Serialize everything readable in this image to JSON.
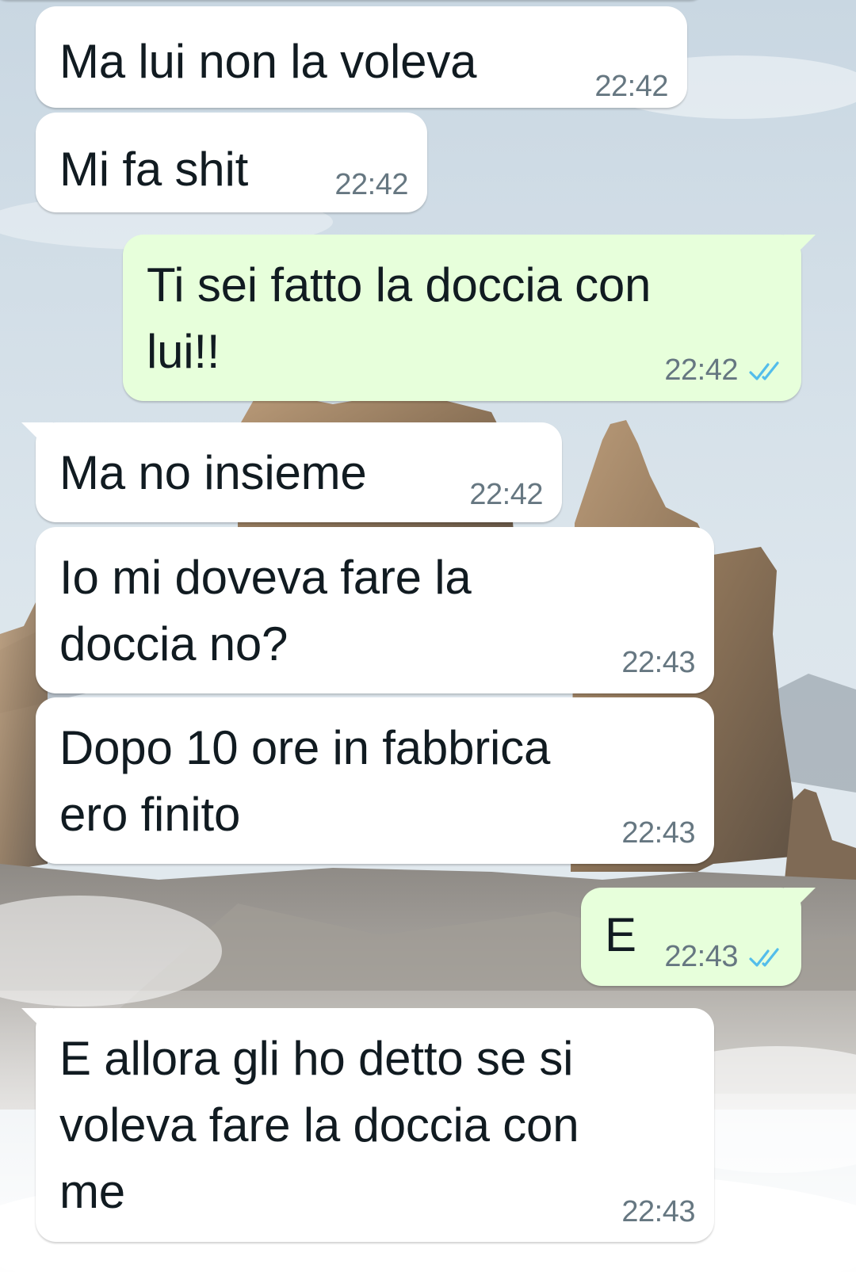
{
  "chat": {
    "messages": [
      {
        "direction": "in",
        "text": "Ma lui non la voleva",
        "time": "22:42"
      },
      {
        "direction": "in",
        "text": "Mi fa shit",
        "time": "22:42"
      },
      {
        "direction": "out",
        "text": "Ti sei fatto la doccia con\nlui!!",
        "time": "22:42",
        "status": "read"
      },
      {
        "direction": "in",
        "text": "Ma no insieme",
        "time": "22:42"
      },
      {
        "direction": "in",
        "text": "Io mi doveva fare la\ndoccia no?",
        "time": "22:43"
      },
      {
        "direction": "in",
        "text": "Dopo 10 ore in fabbrica\nero finito",
        "time": "22:43"
      },
      {
        "direction": "out",
        "text": "E",
        "time": "22:43",
        "status": "read"
      },
      {
        "direction": "in",
        "text": "E allora gli ho detto se si\nvoleva fare la doccia con\nme",
        "time": "22:43"
      }
    ]
  },
  "theme": {
    "incoming_bubble": "#ffffff",
    "outgoing_bubble": "#e7ffdb",
    "timestamp_color": "#667781",
    "read_tick_color": "#53bdeb",
    "wallpaper": "mountain-peaks-above-clouds"
  }
}
